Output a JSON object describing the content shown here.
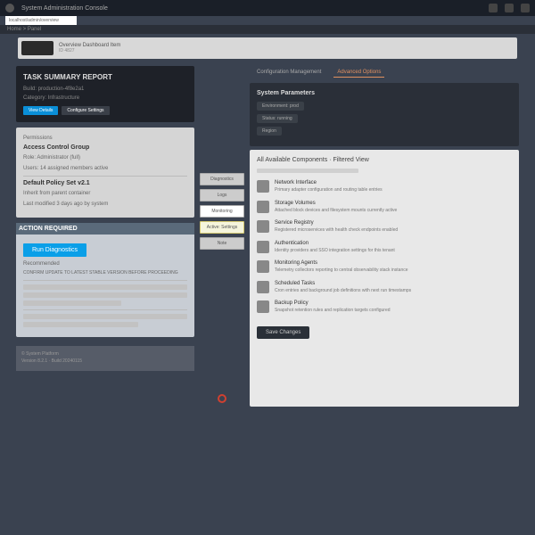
{
  "topbar": {
    "title": "System Administration Console",
    "icons": [
      "grid",
      "help",
      "user"
    ]
  },
  "subbar": "localhost/admin/overview",
  "crumb": "Home > Panel",
  "header": {
    "title": "Overview Dashboard Item",
    "meta": "ID 4827"
  },
  "left": {
    "dark": {
      "title": "TASK SUMMARY REPORT",
      "sub1": "Build: production-4f8e2a1",
      "sub2": "Category: Infrastructure",
      "btn1": "View Details",
      "btn2": "Configure Settings"
    },
    "p1": {
      "label": "Permissions",
      "t1": "Access Control Group",
      "r1": "Role: Administrator (full)",
      "r2": "Users: 14 assigned members active",
      "t2": "Default Policy Set v2.1",
      "r3": "Inherit from parent container",
      "r4": "Last modified 3 days ago by system"
    },
    "p2": {
      "head": "ACTION REQUIRED",
      "btn": "Run Diagnostics",
      "tag": "Recommended",
      "desc": "CONFIRM UPDATE TO LATEST STABLE VERSION BEFORE PROCEEDING"
    },
    "footer": {
      "l1": "© System Platform",
      "l2": "Version 8.2.1 · Build 20240115"
    }
  },
  "mid": {
    "b1": "Diagnostics",
    "b2": "Logs",
    "b3": "Monitoring",
    "b4": "Active: Settings",
    "b5": "Note"
  },
  "right": {
    "tabs": {
      "t1": "Configuration Management",
      "t2": "Advanced Options"
    },
    "dark": {
      "title": "System Parameters",
      "chip1": "Environment: prod",
      "chip2": "Status: running",
      "chip3": "Region"
    },
    "hdr": "All Available Components · Filtered View",
    "items": [
      {
        "t": "Network Interface",
        "d": "Primary adapter configuration and routing table entries"
      },
      {
        "t": "Storage Volumes",
        "d": "Attached block devices and filesystem mounts currently active"
      },
      {
        "t": "Service Registry",
        "d": "Registered microservices with health check endpoints enabled"
      },
      {
        "t": "Authentication",
        "d": "Identity providers and SSO integration settings for this tenant"
      },
      {
        "t": "Monitoring Agents",
        "d": "Telemetry collectors reporting to central observability stack instance"
      },
      {
        "t": "Scheduled Tasks",
        "d": "Cron entries and background job definitions with next run timestamps"
      },
      {
        "t": "Backup Policy",
        "d": "Snapshot retention rules and replication targets configured"
      }
    ],
    "darkbtn": "Save Changes"
  }
}
